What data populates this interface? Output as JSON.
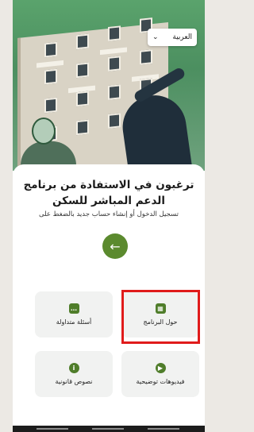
{
  "language_selector": {
    "value": "العربية",
    "icon": "chevron-down-icon"
  },
  "main": {
    "title": "ترغبون في الاستفادة من برنامج الدعم المباشر للسكن",
    "subtitle": "تسجيل الدخول أو إنشاء حساب جديد بالضغط على",
    "go_button_icon": "arrow-left-icon"
  },
  "tiles": [
    {
      "label": "أسئلة متداولة",
      "icon": "chat-icon"
    },
    {
      "label": "حول البرنامج",
      "icon": "calendar-icon"
    },
    {
      "label": "نصوص قانونية",
      "icon": "info-icon"
    },
    {
      "label": "فيديوهات توضيحية",
      "icon": "play-icon"
    }
  ],
  "accent_color": "#5b8a2e",
  "highlight_color": "#e01b1b"
}
